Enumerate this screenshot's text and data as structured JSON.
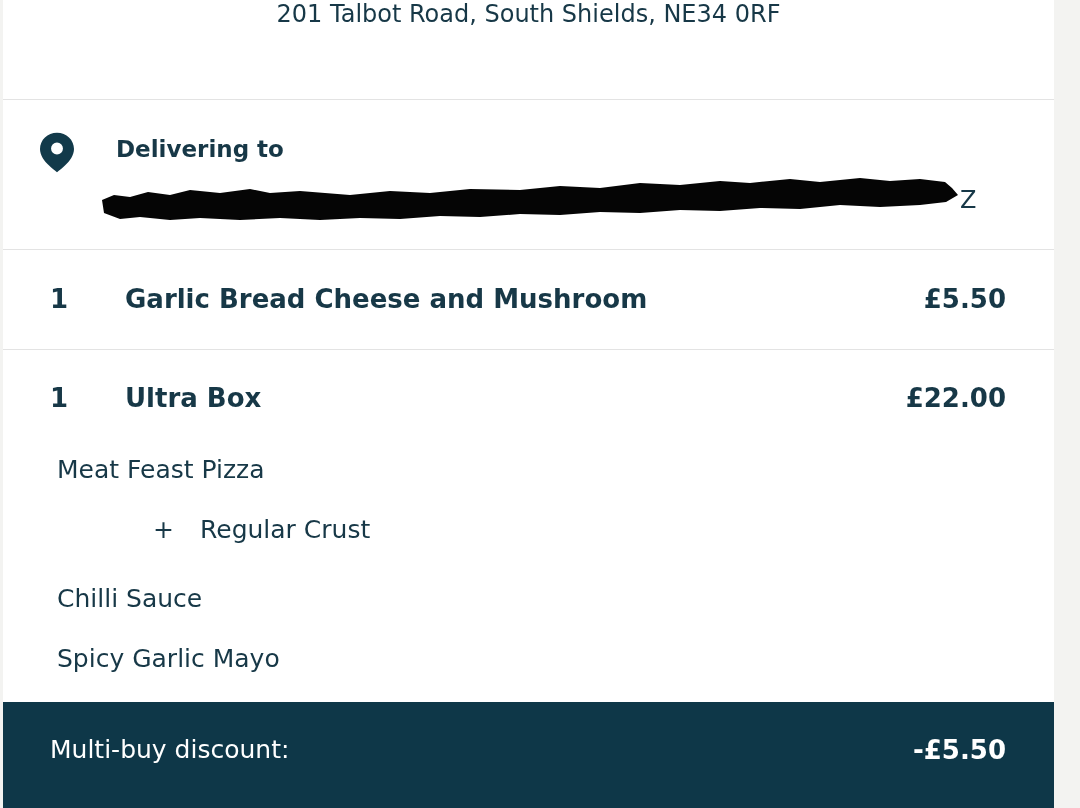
{
  "store_address": "201 Talbot Road, South Shields, NE34 0RF",
  "delivery": {
    "heading": "Delivering to",
    "redacted": true,
    "address_visible": "Z"
  },
  "items": [
    {
      "quantity": "1",
      "name": "Garlic Bread Cheese and Mushroom",
      "price": "£5.50"
    },
    {
      "quantity": "1",
      "name": "Ultra Box",
      "price": "£22.00",
      "options": [
        {
          "name": "Meat Feast Pizza",
          "children": [
            {
              "prefix": "+",
              "name": "Regular Crust"
            }
          ]
        },
        {
          "name": "Chilli Sauce"
        },
        {
          "name": "Spicy Garlic Mayo"
        }
      ]
    }
  ],
  "discount": {
    "label": "Multi-buy discount:",
    "amount": "-£5.50"
  }
}
